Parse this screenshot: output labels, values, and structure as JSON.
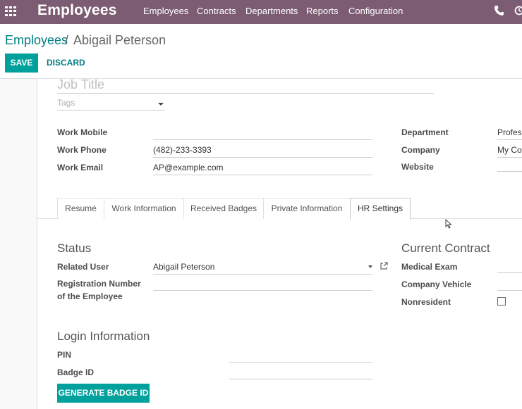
{
  "navbar": {
    "app_name": "Employees",
    "menu": [
      "Employees",
      "Contracts",
      "Departments",
      "Reports",
      "Configuration"
    ],
    "color": "#7c5c73"
  },
  "breadcrumb": {
    "root": "Employees",
    "separator": "/",
    "current": "Abigail Peterson"
  },
  "buttons": {
    "save": "SAVE",
    "discard": "DISCARD",
    "generate_badge": "GENERATE BADGE ID"
  },
  "header": {
    "job_title_placeholder": "Job Title",
    "tags_placeholder": "Tags"
  },
  "contact": {
    "work_mobile": {
      "label": "Work Mobile",
      "value": ""
    },
    "work_phone": {
      "label": "Work Phone",
      "value": "(482)-233-3393"
    },
    "work_email": {
      "label": "Work Email",
      "value": "AP@example.com"
    }
  },
  "org": {
    "department": {
      "label": "Department",
      "value": "Profes"
    },
    "company": {
      "label": "Company",
      "value": "My Co"
    },
    "website": {
      "label": "Website",
      "value": ""
    }
  },
  "tabs": [
    "Resumé",
    "Work Information",
    "Received Badges",
    "Private Information",
    "HR Settings"
  ],
  "active_tab": "HR Settings",
  "status": {
    "title": "Status",
    "related_user": {
      "label": "Related User",
      "value": "Abigail Peterson"
    },
    "registration_number": {
      "label_line1": "Registration Number",
      "label_line2": "of the Employee",
      "value": ""
    }
  },
  "current_contract": {
    "title": "Current Contract",
    "medical_exam": {
      "label": "Medical Exam",
      "value": ""
    },
    "company_vehicle": {
      "label": "Company Vehicle",
      "value": ""
    },
    "nonresident": {
      "label": "Nonresident",
      "checked": false
    }
  },
  "login": {
    "title": "Login Information",
    "pin": {
      "label": "PIN",
      "value": ""
    },
    "badge_id": {
      "label": "Badge ID",
      "value": ""
    }
  },
  "colors": {
    "accent": "#00a09d",
    "link": "#017e84"
  }
}
